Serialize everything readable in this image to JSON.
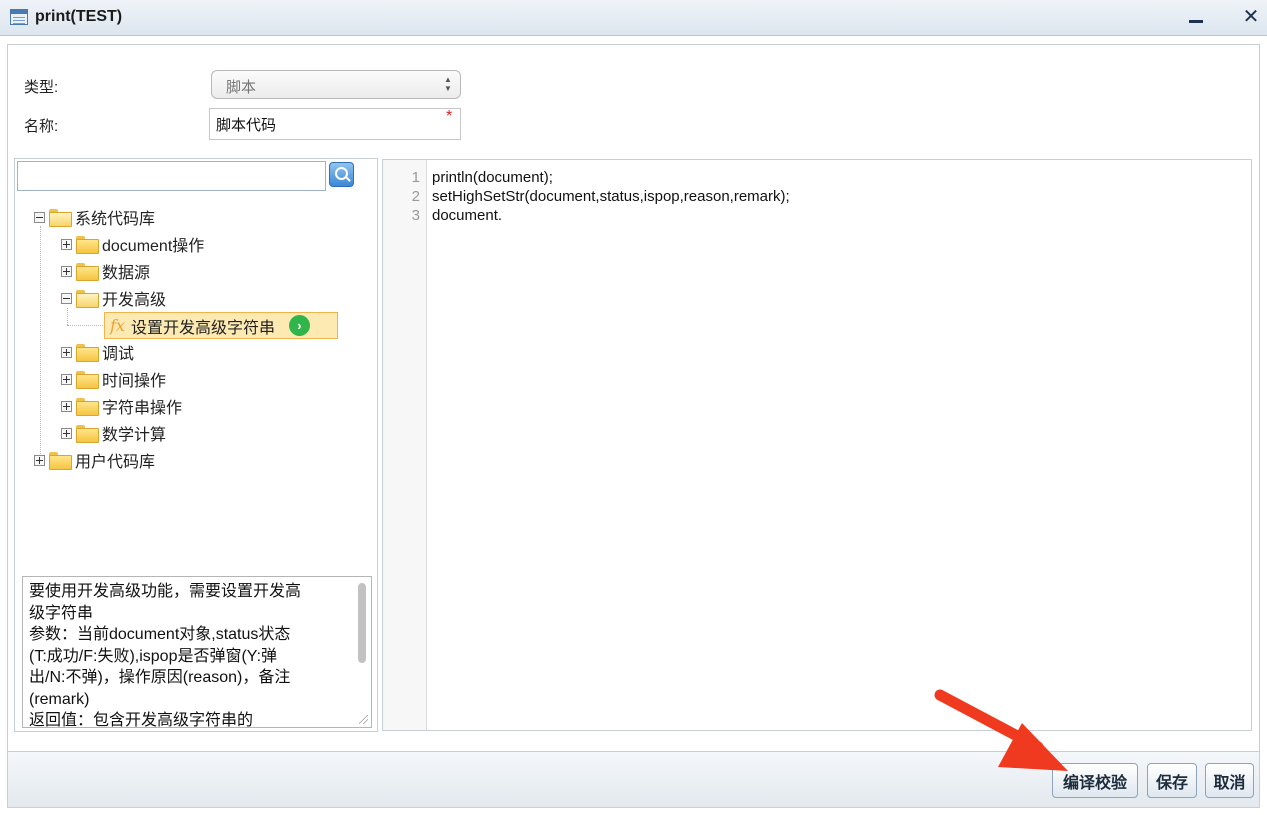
{
  "window": {
    "title": "print(TEST)"
  },
  "form": {
    "type_label": "类型:",
    "type_value": "脚本",
    "name_label": "名称:",
    "name_value": "脚本代码",
    "required_mark": "*"
  },
  "tree": {
    "root": "系统代码库",
    "children": [
      {
        "label": "document操作"
      },
      {
        "label": "数据源"
      },
      {
        "label": "开发高级",
        "leaf": "设置开发高级字符串"
      },
      {
        "label": "调试"
      },
      {
        "label": "时间操作"
      },
      {
        "label": "字符串操作"
      },
      {
        "label": "数学计算"
      }
    ],
    "user_root": "用户代码库"
  },
  "description": {
    "lines": [
      "要使用开发高级功能，需要设置开发高",
      "级字符串",
      "参数：当前document对象,status状态",
      "(T:成功/F:失败),ispop是否弹窗(Y:弹",
      "出/N:不弹)，操作原因(reason)，备注",
      "(remark)",
      "返回值：包含开发高级字符串的"
    ]
  },
  "editor": {
    "lines": [
      {
        "num": "1",
        "code": "println(document);"
      },
      {
        "num": "2",
        "code": "setHighSetStr(document,status,ispop,reason,remark);"
      },
      {
        "num": "3",
        "code": "document."
      }
    ]
  },
  "footer": {
    "check_label": "编译校验",
    "save_label": "保存",
    "cancel_label": "取消"
  },
  "colors": {
    "annotation_arrow": "#f03a1f",
    "selected_leaf_bg": "#fde9b2",
    "go_icon": "#2fb54a"
  }
}
